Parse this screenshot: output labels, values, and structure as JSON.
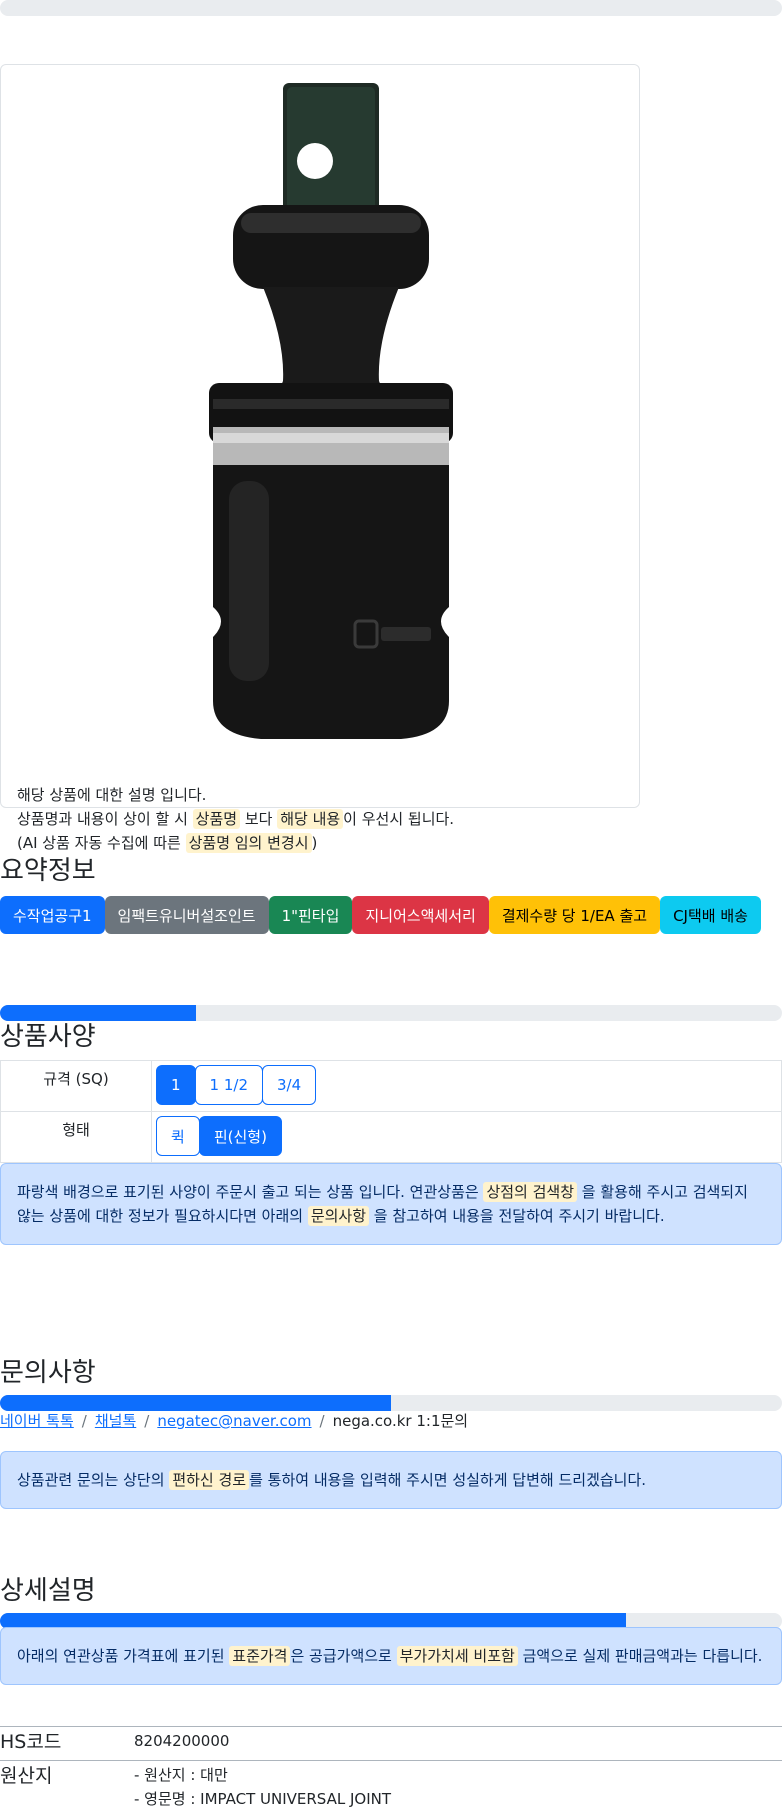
{
  "top_progress": {
    "fraction": 0.0
  },
  "description": {
    "line1": "해당 상품에 대한 설명 입니다.",
    "line2_prefix": "상품명과 내용이 상이 할 시 ",
    "line2_mark1": "상품명",
    "line2_mid": " 보다 ",
    "line2_mark2": "해당 내용",
    "line2_suffix": "이 우선시 됩니다.",
    "line3_prefix": "(AI 상품 자동 수집에 따른 ",
    "line3_mark": "상품명 임의 변경시",
    "line3_suffix": ")"
  },
  "summary": {
    "title": "요약정보",
    "badges": [
      {
        "label": "수작업공구1",
        "bg": "#0d6efd",
        "fg": "#ffffff"
      },
      {
        "label": "임팩트유니버설조인트",
        "bg": "#6c757d",
        "fg": "#ffffff"
      },
      {
        "label": "1\"핀타입",
        "bg": "#198754",
        "fg": "#ffffff"
      },
      {
        "label": "지니어스액세서리",
        "bg": "#dc3545",
        "fg": "#ffffff"
      },
      {
        "label": "결제수량 당 1/EA 출고",
        "bg": "#ffc107",
        "fg": "#000000"
      },
      {
        "label": "CJ택배 배송",
        "bg": "#0dcaf0",
        "fg": "#000000"
      }
    ]
  },
  "specs": {
    "title": "상품사양",
    "progress_fraction": 0.25,
    "rows": [
      {
        "label": "규격 (SQ)",
        "options": [
          {
            "label": "1",
            "active": true
          },
          {
            "label": "1 1/2",
            "active": false
          },
          {
            "label": "3/4",
            "active": false
          }
        ]
      },
      {
        "label": "형태",
        "options": [
          {
            "label": "퀵",
            "active": false
          },
          {
            "label": "핀(신형)",
            "active": true
          }
        ]
      }
    ],
    "notice": {
      "p1": "파랑색 배경으로 표기된 사양이 주문시 출고 되는 상품 입니다. 연관상품은 ",
      "m1": "상점의 검색창",
      "p2": " 을 활용해 주시고 검색되지 않는 상품에 대한 정보가 필요하시다면 아래의 ",
      "m2": "문의사항",
      "p3": " 을 참고하여 내용을 전달하여 주시기 바랍니다."
    }
  },
  "inquiry": {
    "title": "문의사항",
    "progress_fraction": 0.5,
    "links": {
      "naver": "네이버 톡톡",
      "channel": "채널톡",
      "email": "negatec@naver.com",
      "site": "nega.co.kr 1:1문의",
      "sep": "/"
    },
    "notice": {
      "p1": "상품관련 문의는 상단의 ",
      "m1": "편하신 경로",
      "p2": "를 통하여 내용을 입력해 주시면 성실하게 답변해 드리겠습니다."
    }
  },
  "detail": {
    "title": "상세설명",
    "progress_fraction": 0.8,
    "notice": {
      "p1": "아래의 연관상품 가격표에 표기된 ",
      "m1": "표준가격",
      "p2": "은 공급가액으로 ",
      "m2": "부가가치세 비포함",
      "p3": " 금액으로 실제 판매금액과는 다릅니다."
    },
    "hs_label": "HS코드",
    "hs_value": "8204200000",
    "origin_label": "원산지",
    "origin_line1": "- 원산지 : 대만",
    "origin_line2": "- 영문명 : IMPACT UNIVERSAL JOINT"
  }
}
